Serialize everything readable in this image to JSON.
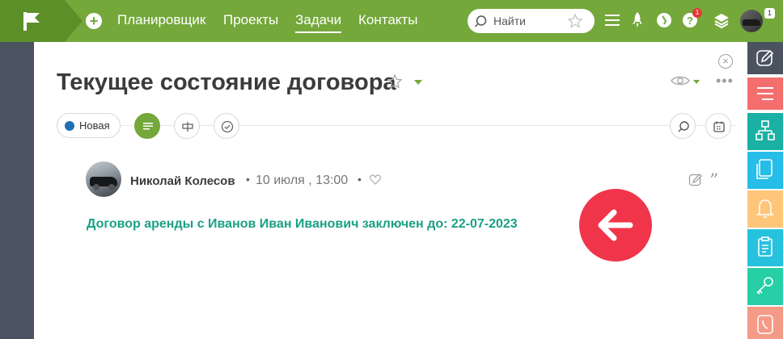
{
  "topbar": {
    "nav": [
      {
        "label": "Планировщик",
        "active": false
      },
      {
        "label": "Проекты",
        "active": false
      },
      {
        "label": "Задачи",
        "active": true
      },
      {
        "label": "Контакты",
        "active": false
      }
    ],
    "search_placeholder": "Найти",
    "help_badge": "1",
    "user_badge": "1",
    "icons": [
      "flag-logo-icon",
      "plus-icon",
      "search-icon",
      "star-icon",
      "menu-icon",
      "rocket-icon",
      "history-icon",
      "help-icon",
      "layers-icon"
    ]
  },
  "task": {
    "title": "Текущее состояние договора",
    "status": "Новая",
    "status_color": "#1f6fb5"
  },
  "comment": {
    "author": "Николай Колесов",
    "date": "10 июля , 13:00",
    "text": "Договор аренды с Иванов Иван Иванович заключен до: 22-07-2023",
    "text_color": "#1aa086"
  },
  "dock": [
    {
      "icon": "edit-icon",
      "color": "#4b5361"
    },
    {
      "icon": "list-icon",
      "color": "#f46e6e"
    },
    {
      "icon": "structure-icon",
      "color": "#1ab0a4"
    },
    {
      "icon": "documents-icon",
      "color": "#26bde8"
    },
    {
      "icon": "bell-icon",
      "color": "#ffc67a"
    },
    {
      "icon": "clipboard-icon",
      "color": "#26c2dd"
    },
    {
      "icon": "key-icon",
      "color": "#26cfa6"
    },
    {
      "icon": "phone-icon",
      "color": "#f59a86"
    }
  ],
  "colors": {
    "accent": "#74a83b",
    "annotation_arrow": "#f0354a"
  }
}
